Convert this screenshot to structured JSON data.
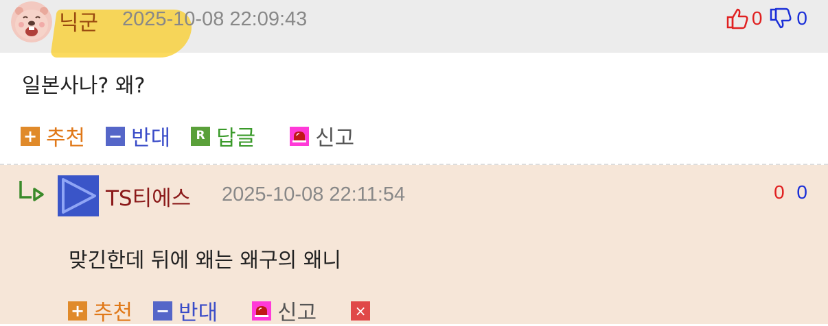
{
  "comment": {
    "author": "닉군",
    "timestamp": "2025-10-08 22:09:43",
    "upvotes": "0",
    "downvotes": "0",
    "body": "일본사나? 왜?",
    "actions": {
      "recommend": "추천",
      "oppose": "반대",
      "reply": "답글",
      "report": "신고"
    },
    "badges": {
      "recommend": "+",
      "oppose": "−",
      "reply": "R"
    }
  },
  "reply": {
    "author": "TS티에스",
    "timestamp": "2025-10-08 22:11:54",
    "upvotes": "0",
    "downvotes": "0",
    "body": "맞긴한데 뒤에 왜는 왜구의 왜니",
    "actions": {
      "recommend": "추천",
      "oppose": "반대",
      "report": "신고"
    },
    "badges": {
      "recommend": "+",
      "oppose": "−",
      "delete": "×"
    }
  },
  "colors": {
    "header_bg": "#ececec",
    "reply_bg": "#f6e6d8",
    "upvote": "#e02020",
    "downvote": "#1a2fd8",
    "recommend": "#e07818",
    "oppose": "#3a4cc8",
    "reply": "#3a9a2a"
  }
}
